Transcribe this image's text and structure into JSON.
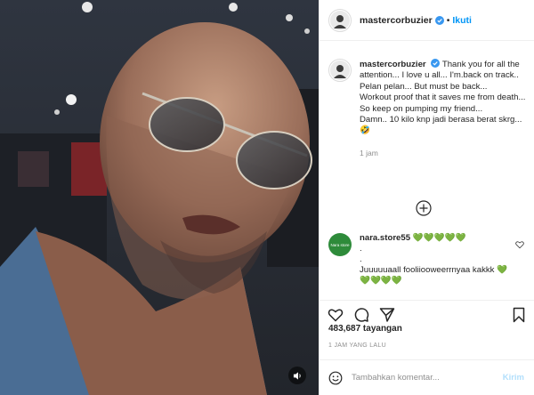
{
  "header": {
    "username": "mastercorbuzier",
    "separator": "•",
    "follow_label": "Ikuti"
  },
  "caption": {
    "username": "mastercorbuzier",
    "lines": [
      "Thank you for all the attention... I love u all... I'm.back on track.. Pelan pelan... But must be back...",
      "Workout proof that it saves me from death...",
      "So keep on pumping my friend...",
      "Damn.. 10 kilo knp jadi berasa berat skrg... 🤣"
    ],
    "time": "1 jam"
  },
  "comment": {
    "avatar_text": "Nara store",
    "username": "nara.store55",
    "line1_hearts": "💚💚💚💚💚",
    "dot1": ".",
    "dot2": ".",
    "text": "Juuuuuaall fooliiooweerrnyaa kakkk",
    "text_hearts": "💚💚💚💚💚"
  },
  "stats": {
    "views": "483,687 tayangan",
    "date": "1 JAM YANG LALU"
  },
  "add_comment": {
    "placeholder": "Tambahkan komentar...",
    "post_label": "Kirim"
  },
  "icons": {
    "like": "heart-icon",
    "comment": "comment-icon",
    "share": "share-icon",
    "save": "bookmark-icon",
    "emoji": "smiley-icon",
    "more": "plus-circle-icon",
    "mute": "volume-icon",
    "verified": "verified-badge-icon"
  },
  "colors": {
    "link_blue": "#0095f6",
    "verified_blue": "#3897f0",
    "green_heart": "#2db51b",
    "muted_text": "#8e8e8e"
  }
}
